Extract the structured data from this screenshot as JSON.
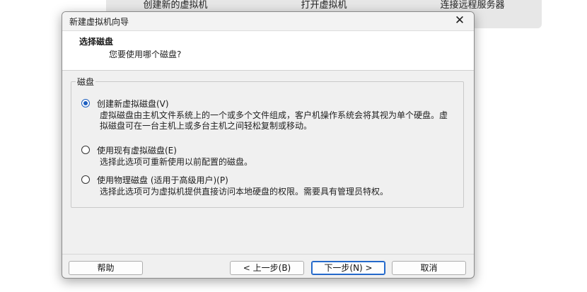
{
  "background": {
    "buttons": [
      "创建新的虚拟机",
      "打开虚拟机",
      "连接远程服务器"
    ]
  },
  "dialog": {
    "title": "新建虚拟机向导",
    "close_icon": "close-icon",
    "header_title": "选择磁盘",
    "header_subtitle": "您要使用哪个磁盘?",
    "group_label": "磁盘",
    "options": [
      {
        "label": "创建新虚拟磁盘(V)",
        "selected": true,
        "description": "虚拟磁盘由主机文件系统上的一个或多个文件组成，客户机操作系统会将其视为单个硬盘。虚拟磁盘可在一台主机上或多台主机之间轻松复制或移动。"
      },
      {
        "label": "使用现有虚拟磁盘(E)",
        "selected": false,
        "description": "选择此选项可重新使用以前配置的磁盘。"
      },
      {
        "label": "使用物理磁盘 (适用于高级用户)(P)",
        "selected": false,
        "description": "选择此选项可为虚拟机提供直接访问本地硬盘的权限。需要具有管理员特权。"
      }
    ],
    "buttons": {
      "help": "帮助",
      "back": "< 上一步(B)",
      "next": "下一步(N) >",
      "cancel": "取消"
    }
  },
  "colors": {
    "accent": "#1e5fbf"
  }
}
